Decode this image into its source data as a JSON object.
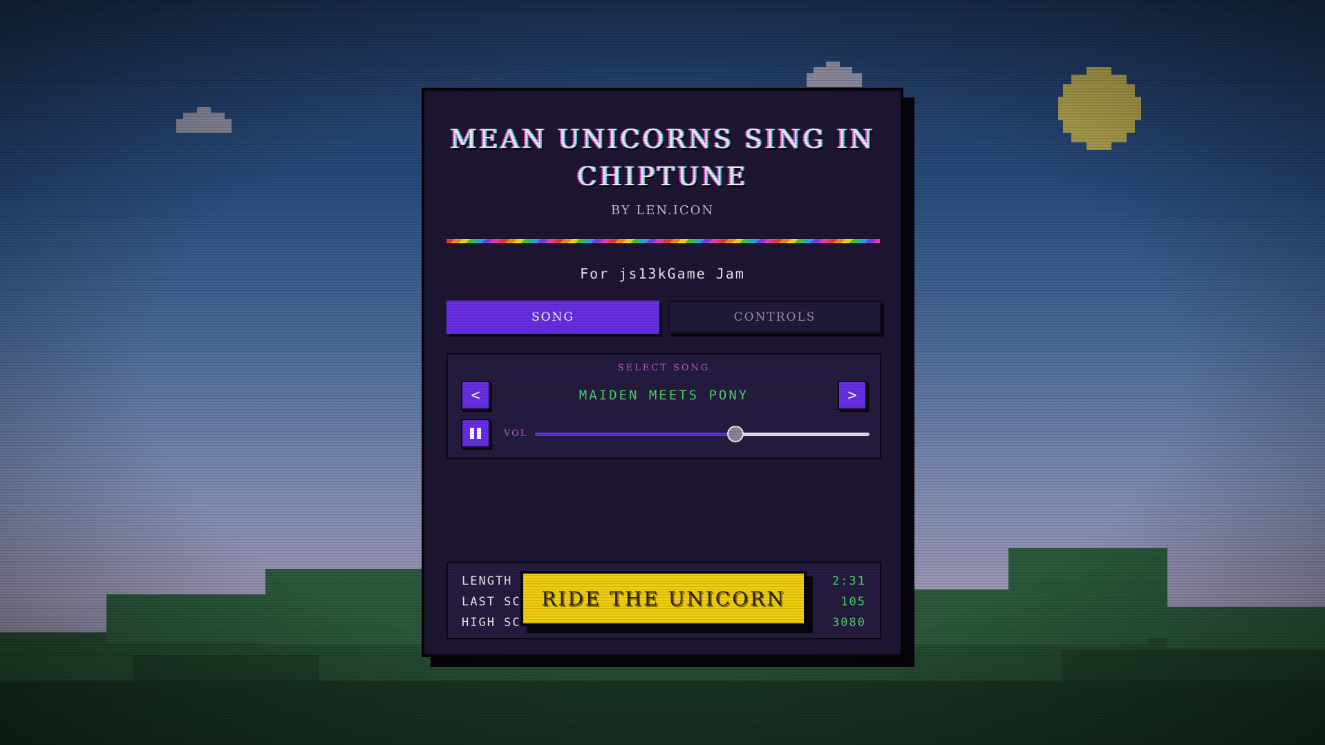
{
  "game": {
    "title": "MEAN UNICORNS SING IN CHIPTUNE",
    "byline": "BY LEN.ICON",
    "jam": "For js13kGame Jam"
  },
  "tabs": [
    {
      "label": "SONG",
      "active": true
    },
    {
      "label": "CONTROLS",
      "active": false
    }
  ],
  "song_panel": {
    "select_label": "SELECT SONG",
    "prev_label": "<",
    "next_label": ">",
    "song_name": "MAIDEN MEETS PONY",
    "volume_label": "VOL",
    "volume_fraction": 0.6,
    "playing": true
  },
  "stats": [
    {
      "label": "LENGTH",
      "value": "2:31"
    },
    {
      "label": "LAST SCORE",
      "value": "105"
    },
    {
      "label": "HIGH SCORE",
      "value": "3080"
    }
  ],
  "play_button": {
    "label": "RIDE THE UNICORN"
  },
  "colors": {
    "accent": "#6a2ee6",
    "panel": "#1e1633",
    "song_green": "#4fd46a",
    "play_yellow": "#f3d00e",
    "label_pink": "#c25ccf"
  }
}
